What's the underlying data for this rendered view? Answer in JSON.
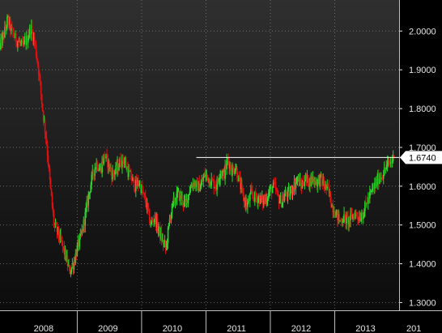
{
  "colors": {
    "background": "#000000",
    "plot_top": "#2f2f2f",
    "plot_bottom": "#0c0c0c",
    "up": "#2bd62b",
    "down": "#e01010",
    "grid": "#8a8a8a",
    "text": "#e6e6e6",
    "level_line": "#ffffff"
  },
  "chart_data": {
    "type": "candlestick",
    "x_tick_labels": [
      "2008",
      "2009",
      "2010",
      "2011",
      "2012",
      "2013",
      "201"
    ],
    "y_tick_labels": [
      "2.0000",
      "1.9000",
      "1.8000",
      "1.7000",
      "1.6000",
      "1.5000",
      "1.4000",
      "1.3000"
    ],
    "ylim": [
      1.28,
      2.08
    ],
    "xlim": [
      2007.8,
      2014.0
    ],
    "grid": true,
    "last_value": 1.674,
    "last_value_label": "1.6740",
    "level_line": {
      "value": 1.674,
      "from_year": 2010.85
    },
    "series": {
      "t": [
        2007.8,
        2007.86,
        2007.92,
        2007.98,
        2008.04,
        2008.1,
        2008.16,
        2008.22,
        2008.28,
        2008.34,
        2008.4,
        2008.46,
        2008.52,
        2008.58,
        2008.64,
        2008.7,
        2008.76,
        2008.82,
        2008.88,
        2008.94,
        2009.0,
        2009.06,
        2009.12,
        2009.18,
        2009.24,
        2009.3,
        2009.36,
        2009.42,
        2009.48,
        2009.54,
        2009.6,
        2009.66,
        2009.72,
        2009.78,
        2009.84,
        2009.9,
        2009.96,
        2010.02,
        2010.08,
        2010.14,
        2010.2,
        2010.26,
        2010.32,
        2010.38,
        2010.44,
        2010.5,
        2010.56,
        2010.62,
        2010.68,
        2010.74,
        2010.8,
        2010.86,
        2010.92,
        2010.98,
        2011.04,
        2011.1,
        2011.16,
        2011.22,
        2011.28,
        2011.34,
        2011.4,
        2011.46,
        2011.52,
        2011.58,
        2011.64,
        2011.7,
        2011.76,
        2011.82,
        2011.88,
        2011.94,
        2012.0,
        2012.06,
        2012.12,
        2012.18,
        2012.24,
        2012.3,
        2012.36,
        2012.42,
        2012.48,
        2012.54,
        2012.6,
        2012.66,
        2012.72,
        2012.78,
        2012.84,
        2012.9,
        2012.96,
        2013.02,
        2013.08,
        2013.14,
        2013.2,
        2013.26,
        2013.32,
        2013.38,
        2013.44,
        2013.5,
        2013.56,
        2013.62,
        2013.68,
        2013.74,
        2013.8,
        2013.86,
        2013.92
      ],
      "v": [
        1.96,
        1.99,
        2.03,
        2.0,
        1.98,
        1.97,
        1.96,
        1.98,
        2.01,
        1.97,
        1.9,
        1.8,
        1.72,
        1.6,
        1.5,
        1.48,
        1.45,
        1.42,
        1.38,
        1.4,
        1.44,
        1.47,
        1.52,
        1.58,
        1.63,
        1.66,
        1.64,
        1.68,
        1.66,
        1.63,
        1.64,
        1.66,
        1.67,
        1.64,
        1.62,
        1.6,
        1.61,
        1.58,
        1.55,
        1.5,
        1.52,
        1.49,
        1.46,
        1.44,
        1.52,
        1.56,
        1.58,
        1.57,
        1.55,
        1.59,
        1.61,
        1.6,
        1.6,
        1.63,
        1.62,
        1.61,
        1.6,
        1.64,
        1.63,
        1.67,
        1.64,
        1.65,
        1.61,
        1.57,
        1.55,
        1.58,
        1.57,
        1.57,
        1.56,
        1.57,
        1.59,
        1.6,
        1.57,
        1.56,
        1.58,
        1.58,
        1.6,
        1.62,
        1.6,
        1.62,
        1.61,
        1.62,
        1.61,
        1.62,
        1.6,
        1.59,
        1.55,
        1.53,
        1.51,
        1.52,
        1.51,
        1.52,
        1.53,
        1.52,
        1.53,
        1.56,
        1.58,
        1.6,
        1.62,
        1.63,
        1.65,
        1.66,
        1.674
      ]
    }
  }
}
